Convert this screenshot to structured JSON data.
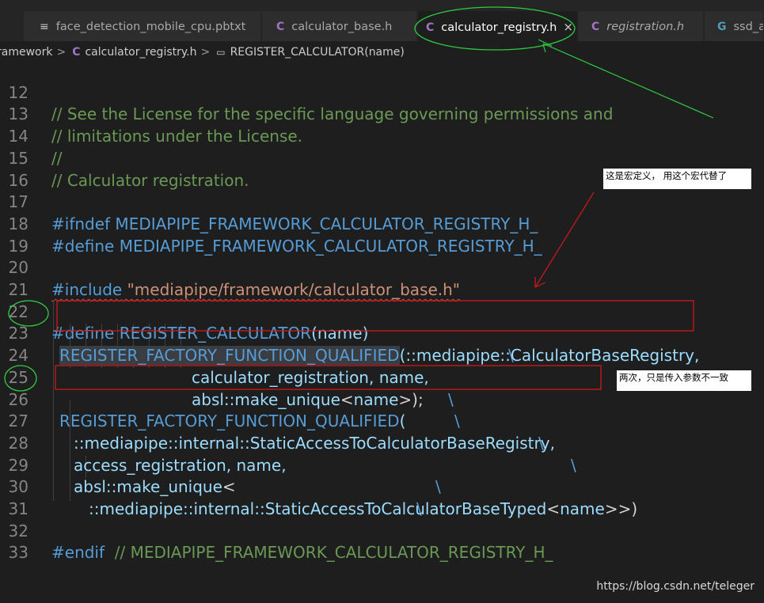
{
  "tabs": [
    {
      "icon": "≡",
      "label": "face_detection_mobile_cpu.pbtxt",
      "italic": false
    },
    {
      "icon": "C",
      "label": "calculator_base.h",
      "italic": false
    },
    {
      "icon": "C",
      "label": "calculator_registry.h",
      "italic": false,
      "active": true
    },
    {
      "icon": "C",
      "label": "registration.h",
      "italic": true
    },
    {
      "icon": "G",
      "label": "ssd_a",
      "italic": false
    }
  ],
  "close_glyph": "×",
  "breadcrumb": {
    "folder": "ramework",
    "sep": ">",
    "file_icon": "C",
    "file": "calculator_registry.h",
    "symbol_icon": "▭",
    "symbol": "REGISTER_CALCULATOR(name)"
  },
  "code": {
    "lines": [
      {
        "n": "12",
        "a": "// See the License for the specific language governing permissions and"
      },
      {
        "n": "13",
        "a": "// limitations under the License."
      },
      {
        "n": "14",
        "a": "//"
      },
      {
        "n": "15",
        "a": "// Calculator registration."
      },
      {
        "n": "16"
      },
      {
        "n": "17",
        "a": "#ifndef",
        "b": " MEDIAPIPE_FRAMEWORK_CALCULATOR_REGISTRY_H_"
      },
      {
        "n": "18",
        "a": "#define",
        "b": " MEDIAPIPE_FRAMEWORK_CALCULATOR_REGISTRY_H_"
      },
      {
        "n": "19"
      },
      {
        "n": "20",
        "a": "#include",
        "b": " \"mediapipe/framework/calculator_base.h\""
      },
      {
        "n": "21"
      },
      {
        "n": "22",
        "a": "#define",
        "b": " REGISTER_CALCULATOR",
        "c": "(name)",
        "d": "\\"
      },
      {
        "n": "23",
        "a": "REGISTER_FACTORY_FUNCTION_QUALIFIED",
        "b": "(::mediapipe::CalculatorBaseRegistry,",
        "d": "\\"
      },
      {
        "n": "24",
        "a": "calculator_registration, name,",
        "d": "\\"
      },
      {
        "n": "25",
        "a": "absl::make_unique",
        "b": "<",
        "c": "name",
        "e": ">);",
        "d": "\\"
      },
      {
        "n": "26",
        "a": "REGISTER_FACTORY_FUNCTION_QUALIFIED",
        "b": "(",
        "d": "\\"
      },
      {
        "n": "27",
        "a": "::mediapipe::internal::StaticAccessToCalculatorBaseRegistry,",
        "d": "\\"
      },
      {
        "n": "28",
        "a": "access_registration, name,",
        "d": "\\"
      },
      {
        "n": "29",
        "a": "absl::make_unique",
        "b": "<",
        "d": "\\"
      },
      {
        "n": "30",
        "a": "::mediapipe::internal::StaticAccessToCalculatorBaseTyped",
        "b": "<",
        "c": "name",
        "e": ">>)"
      },
      {
        "n": "31"
      },
      {
        "n": "32",
        "a": "#endif",
        "b": "  // MEDIAPIPE_FRAMEWORK_CALCULATOR_REGISTRY_H_"
      },
      {
        "n": "33"
      }
    ]
  },
  "annotations": {
    "note1": "这是宏定义，    用这个宏代替了",
    "note2": "两次，只是传入参数不一致"
  },
  "watermark": "https://blog.csdn.net/teleger",
  "colors": {
    "comment": "#6a9955",
    "keyword": "#569cd6",
    "string": "#ce9178",
    "identifier": "#9cdcfe",
    "annotation_red": "#d0181a",
    "annotation_green": "#2ecc40"
  }
}
